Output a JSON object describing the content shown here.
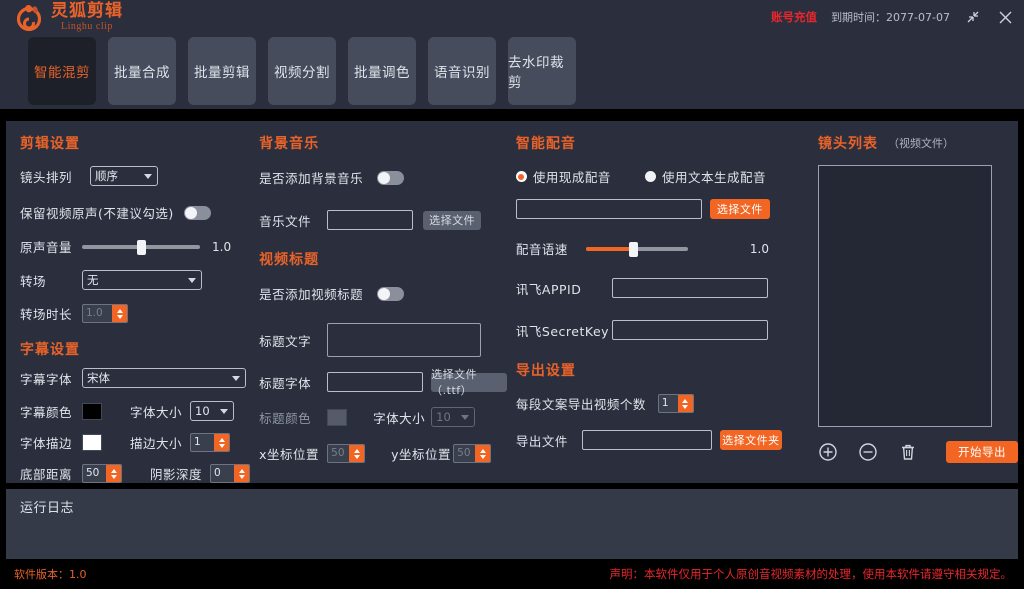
{
  "titlebar": {
    "logo_title": "灵狐剪辑",
    "logo_sub": "Linghu clip",
    "recharge_label": "账号充值",
    "expire_label": "到期时间：2077-07-07",
    "minimize_name": "minimize-icon",
    "close_name": "close-icon"
  },
  "tabs": [
    {
      "label": "智能混剪",
      "active": true
    },
    {
      "label": "批量合成",
      "active": false
    },
    {
      "label": "批量剪辑",
      "active": false
    },
    {
      "label": "视频分割",
      "active": false
    },
    {
      "label": "批量调色",
      "active": false
    },
    {
      "label": "语音识别",
      "active": false
    },
    {
      "label": "去水印裁剪",
      "active": false
    }
  ],
  "clip_settings": {
    "section_title": "剪辑设置",
    "arrange_label": "镜头排列",
    "arrange_value": "顺序",
    "keep_audio_label": "保留视频原声(不建议勾选)",
    "keep_audio_on": false,
    "volume_label": "原声音量",
    "volume_value": "1.0",
    "volume_pct": 50,
    "volume_fill_pct": 0,
    "transition_label": "转场",
    "transition_value": "无",
    "transition_dur_label": "转场时长",
    "transition_dur_value": "1.0"
  },
  "subtitle_settings": {
    "section_title": "字幕设置",
    "font_label": "字幕字体",
    "font_value": "宋体",
    "color_label": "字幕颜色",
    "color_value": "#000000",
    "size_label": "字体大小",
    "size_value": "10",
    "stroke_label": "字体描边",
    "stroke_color": "#ffffff",
    "stroke_size_label": "描边大小",
    "stroke_size_value": "1",
    "bottom_label": "底部距离",
    "bottom_value": "50",
    "shadow_label": "阴影深度",
    "shadow_value": "0"
  },
  "bgm": {
    "section_title": "背景音乐",
    "enable_label": "是否添加背景音乐",
    "enable_on": false,
    "file_label": "音乐文件",
    "file_value": "",
    "choose_label": "选择文件"
  },
  "video_title": {
    "section_title": "视频标题",
    "enable_label": "是否添加视频标题",
    "enable_on": false,
    "text_label": "标题文字",
    "text_value": "",
    "font_label": "标题字体",
    "font_value": "",
    "choose_font_label": "选择文件（.ttf）",
    "color_label": "标题颜色",
    "color_value": "#565b69",
    "size_label": "字体大小",
    "size_value": "10",
    "x_label": "x坐标位置",
    "x_value": "50",
    "y_label": "y坐标位置",
    "y_value": "50"
  },
  "dubbing": {
    "section_title": "智能配音",
    "radio_existing_label": "使用现成配音",
    "radio_existing_selected": true,
    "radio_tts_label": "使用文本生成配音",
    "radio_tts_selected": false,
    "file_value": "",
    "choose_label": "选择文件",
    "speed_label": "配音语速",
    "speed_value": "1.0",
    "speed_pct": 46,
    "appid_label": "讯飞APPID",
    "appid_value": "",
    "secret_label": "讯飞SecretKey",
    "secret_value": ""
  },
  "export_settings": {
    "section_title": "导出设置",
    "count_label": "每段文案导出视频个数",
    "count_value": "1",
    "file_label": "导出文件",
    "file_value": "",
    "choose_folder_label": "选择文件夹"
  },
  "shot_list": {
    "section_title": "镜头列表",
    "section_note": "（视频文件）",
    "items": [],
    "add_icon": "plus-circle-icon",
    "remove_icon": "minus-circle-icon",
    "clear_icon": "trash-icon",
    "start_label": "开始导出"
  },
  "log": {
    "title": "运行日志",
    "lines": []
  },
  "footer": {
    "version": "软件版本：1.0",
    "disclaimer": "声明：本软件仅用于个人原创音视频素材的处理，使用本软件请遵守相关规定。"
  },
  "colors": {
    "accent": "#f26522",
    "danger": "#e8262d",
    "panel": "#2b2f3d",
    "tab": "#474c5d"
  }
}
